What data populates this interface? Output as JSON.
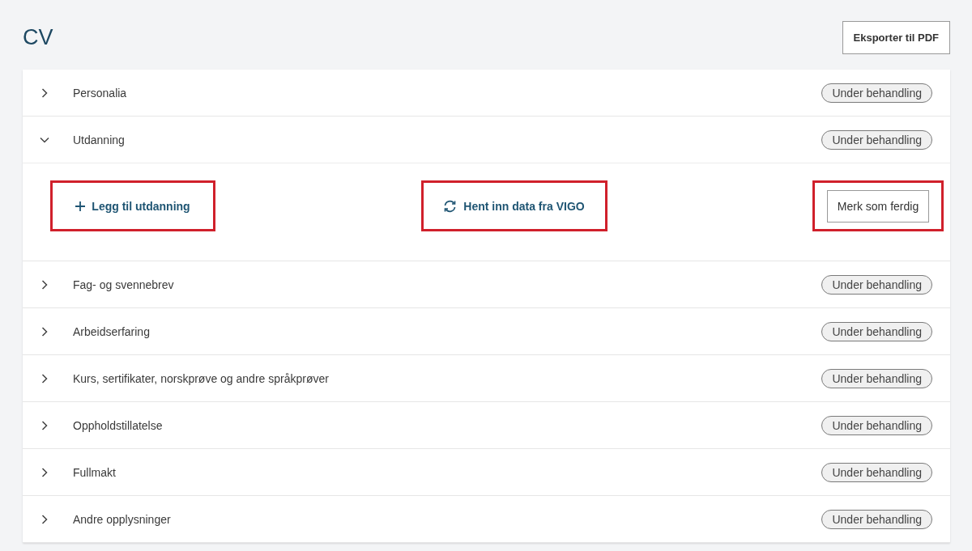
{
  "page": {
    "title": "CV",
    "export_button": "Eksporter til PDF"
  },
  "sections": [
    {
      "title": "Personalia",
      "expanded": false,
      "status": "Under behandling"
    },
    {
      "title": "Utdanning",
      "expanded": true,
      "status": "Under behandling",
      "actions": [
        {
          "kind": "add",
          "label": "Legg til utdanning",
          "highlighted": true
        },
        {
          "kind": "sync",
          "label": "Hent inn data fra VIGO",
          "highlighted": true
        },
        {
          "kind": "button",
          "label": "Merk som ferdig",
          "highlighted": true
        }
      ]
    },
    {
      "title": "Fag- og svennebrev",
      "expanded": false,
      "status": "Under behandling"
    },
    {
      "title": "Arbeidserfaring",
      "expanded": false,
      "status": "Under behandling"
    },
    {
      "title": "Kurs, sertifikater, norskprøve og andre språkprøver",
      "expanded": false,
      "status": "Under behandling"
    },
    {
      "title": "Oppholdstillatelse",
      "expanded": false,
      "status": "Under behandling"
    },
    {
      "title": "Fullmakt",
      "expanded": false,
      "status": "Under behandling"
    },
    {
      "title": "Andre opplysninger",
      "expanded": false,
      "status": "Under behandling"
    }
  ]
}
